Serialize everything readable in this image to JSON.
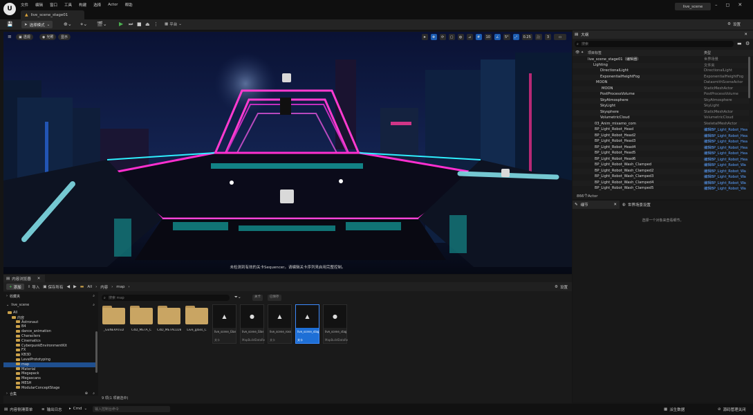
{
  "titlebar": {
    "logo": "U",
    "menu": [
      "文件",
      "编辑",
      "窗口",
      "工具",
      "构建",
      "选择",
      "Actor",
      "帮助"
    ],
    "doc_tab": "live_scene_stage01",
    "project": "live_scene",
    "controls": [
      "–",
      "◻",
      "✕"
    ]
  },
  "toolbar": {
    "select_mode": "选择模式",
    "platform": "平台",
    "settings": "设置"
  },
  "viewport": {
    "left_pills": [
      "透视",
      "光照",
      "显示"
    ],
    "right_values": {
      "grid": "10",
      "angle": "5°",
      "scale": "0.25",
      "cam": "3"
    },
    "message": "未检测到有效的关卡Sequencer。请编辑关卡序列来启用完整控制。"
  },
  "outliner": {
    "tab": "大纲",
    "search_placeholder": "搜索",
    "col_label": "项目标签",
    "col_type": "类型",
    "count": "866个Actor",
    "rows": [
      {
        "name": "live_scene_stage01（编辑器）",
        "type": "世界场景",
        "link": false
      },
      {
        "name": "Lighting",
        "type": "文件夹",
        "link": false
      },
      {
        "name": "DirectionalLight",
        "type": "DirectionalLight",
        "link": false
      },
      {
        "name": "ExponentialHeightFog",
        "type": "ExponentialHeightFog",
        "link": false
      },
      {
        "name": "MOON",
        "type": "DatasmithSceneActor",
        "link": false
      },
      {
        "name": "MOON",
        "type": "StaticMeshActor",
        "link": false
      },
      {
        "name": "PostProcessVolume",
        "type": "PostProcessVolume",
        "link": false
      },
      {
        "name": "SkyAtmosphere",
        "type": "SkyAtmosphere",
        "link": false
      },
      {
        "name": "SkyLight",
        "type": "SkyLight",
        "link": false
      },
      {
        "name": "Skysphere",
        "type": "StaticMeshActor",
        "link": false
      },
      {
        "name": "VolumetricCloud",
        "type": "VolumetricCloud",
        "link": false
      },
      {
        "name": "03_Anim_mixamo_com",
        "type": "SkeletalMeshActor",
        "link": false
      },
      {
        "name": "BP_Light_Robot_Head",
        "type": "编辑BP_Light_Robot_Hea",
        "link": true
      },
      {
        "name": "BP_Light_Robot_Head2",
        "type": "编辑BP_Light_Robot_Hea",
        "link": true
      },
      {
        "name": "BP_Light_Robot_Head3",
        "type": "编辑BP_Light_Robot_Hea",
        "link": true
      },
      {
        "name": "BP_Light_Robot_Head4",
        "type": "编辑BP_Light_Robot_Hea",
        "link": true
      },
      {
        "name": "BP_Light_Robot_Head5",
        "type": "编辑BP_Light_Robot_Hea",
        "link": true
      },
      {
        "name": "BP_Light_Robot_Head6",
        "type": "编辑BP_Light_Robot_Hea",
        "link": true
      },
      {
        "name": "BP_Light_Robot_Wash_Clamped",
        "type": "编辑BP_Light_Robot_Wa",
        "link": true
      },
      {
        "name": "BP_Light_Robot_Wash_Clamped2",
        "type": "编辑BP_Light_Robot_Wa",
        "link": true
      },
      {
        "name": "BP_Light_Robot_Wash_Clamped3",
        "type": "编辑BP_Light_Robot_Wa",
        "link": true
      },
      {
        "name": "BP_Light_Robot_Wash_Clamped4",
        "type": "编辑BP_Light_Robot_Wa",
        "link": true
      },
      {
        "name": "BP_Light_Robot_Wash_Clamped5",
        "type": "编辑BP_Light_Robot_Wa",
        "link": true
      }
    ]
  },
  "details": {
    "tab1": "细节",
    "tab2": "世界场景设置",
    "empty": "选择一个对象来查看细节。"
  },
  "content_browser": {
    "tab": "内容浏览器",
    "add": "添加",
    "import": "导入",
    "save_all": "保存所有",
    "breadcrumb": [
      "All",
      "内容",
      "map"
    ],
    "settings": "设置",
    "favorites": "收藏夹",
    "project": "live_scene",
    "search_placeholder": "搜索 map",
    "filter1": "关卡",
    "filter2": "已保存",
    "collections": "合集",
    "summary": "9 项(1 项被选中)",
    "tree": [
      {
        "label": "All",
        "indent": 1
      },
      {
        "label": "内容",
        "indent": 2
      },
      {
        "label": "Astronaut",
        "indent": 3
      },
      {
        "label": "B4",
        "indent": 3
      },
      {
        "label": "dance_animation",
        "indent": 3
      },
      {
        "label": "Characters",
        "indent": 3
      },
      {
        "label": "Cinematics",
        "indent": 3
      },
      {
        "label": "CyberpunkEnvironmentKit",
        "indent": 3
      },
      {
        "label": "FX",
        "indent": 3
      },
      {
        "label": "KB3D",
        "indent": 3
      },
      {
        "label": "LevelPrototyping",
        "indent": 3
      },
      {
        "label": "map",
        "indent": 3,
        "selected": true
      },
      {
        "label": "Material",
        "indent": 3
      },
      {
        "label": "Megapack",
        "indent": 3
      },
      {
        "label": "Megascans",
        "indent": 3
      },
      {
        "label": "MESH",
        "indent": 3
      },
      {
        "label": "ModularConceptStage",
        "indent": 3
      }
    ],
    "assets": [
      {
        "kind": "folder",
        "label": "_GENERATED"
      },
      {
        "kind": "folder",
        "label": "C4D_META_C"
      },
      {
        "kind": "folder",
        "label": "C4D_METACLUB_C"
      },
      {
        "kind": "folder",
        "label": "Live_glass_C"
      },
      {
        "kind": "map",
        "label": "live_scene_Glass",
        "type": "关卡",
        "icon": "▲"
      },
      {
        "kind": "map",
        "label": "live_scene_Glass_BuiltData",
        "type": "MapBuildDataRe",
        "icon": "●"
      },
      {
        "kind": "map",
        "label": "live_scene_rosso",
        "type": "关卡",
        "icon": "▲"
      },
      {
        "kind": "map",
        "label": "live_scene_stage01",
        "type": "关卡",
        "icon": "▲",
        "selected": true
      },
      {
        "kind": "map",
        "label": "live_scene_stage01_Built",
        "type": "MapBuildDataRe",
        "icon": "●"
      }
    ]
  },
  "statusbar": {
    "drawer": "内容侧滑菜单",
    "output": "输出日志",
    "cmd": "Cmd",
    "cmd_placeholder": "输入控制台命令",
    "derived": "派生数据",
    "source": "源码管理关闭"
  }
}
